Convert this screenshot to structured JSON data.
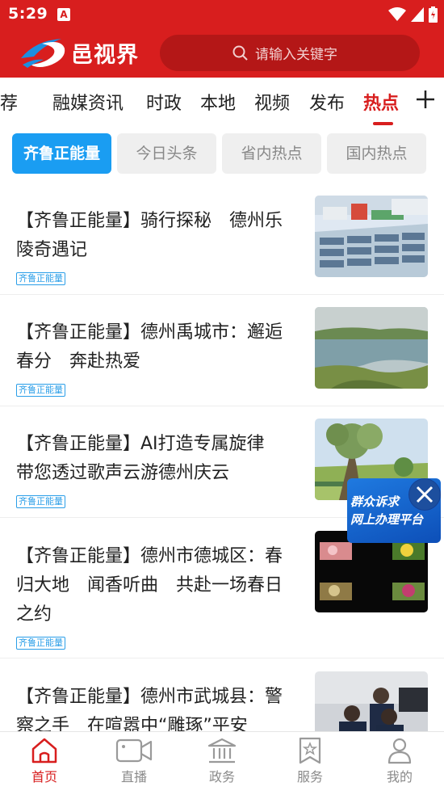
{
  "status_bar": {
    "time": "5:29",
    "app_icon": "A"
  },
  "header": {
    "logo_text": "邑视界",
    "search_placeholder": "请输入关键字",
    "accent_color": "#d81e1e"
  },
  "tabs": [
    {
      "label": "推荐"
    },
    {
      "label": "融媒资讯"
    },
    {
      "label": "时政"
    },
    {
      "label": "本地"
    },
    {
      "label": "视频"
    },
    {
      "label": "发布"
    },
    {
      "label": "热点",
      "active": true
    }
  ],
  "sub_tabs": [
    {
      "label": "齐鲁正能量",
      "active": true
    },
    {
      "label": "今日头条"
    },
    {
      "label": "省内热点"
    },
    {
      "label": "国内热点"
    }
  ],
  "news": [
    {
      "title": "【齐鲁正能量】骑行探秘　德州乐陵奇遇记",
      "tag": "齐鲁正能量"
    },
    {
      "title": "【齐鲁正能量】德州禹城市：邂逅春分　奔赴热爱",
      "tag": "齐鲁正能量"
    },
    {
      "title": "【齐鲁正能量】AI打造专属旋律　带您透过歌声云游德州庆云",
      "tag": "齐鲁正能量"
    },
    {
      "title": "【齐鲁正能量】德州市德城区：春归大地　闻香听曲　共赴一场春日之约",
      "tag": "齐鲁正能量"
    },
    {
      "title": "【齐鲁正能量】德州市武城县：警察之手　在喧嚣中“雕琢”平安",
      "tag": ""
    }
  ],
  "float_badge": {
    "line1": "群众诉求",
    "line2": "网上办理平台"
  },
  "bottom_nav": [
    {
      "label": "首页",
      "icon": "home-icon",
      "active": true
    },
    {
      "label": "直播",
      "icon": "video-camera-icon"
    },
    {
      "label": "政务",
      "icon": "government-building-icon"
    },
    {
      "label": "服务",
      "icon": "bookmark-star-icon"
    },
    {
      "label": "我的",
      "icon": "user-icon"
    }
  ]
}
